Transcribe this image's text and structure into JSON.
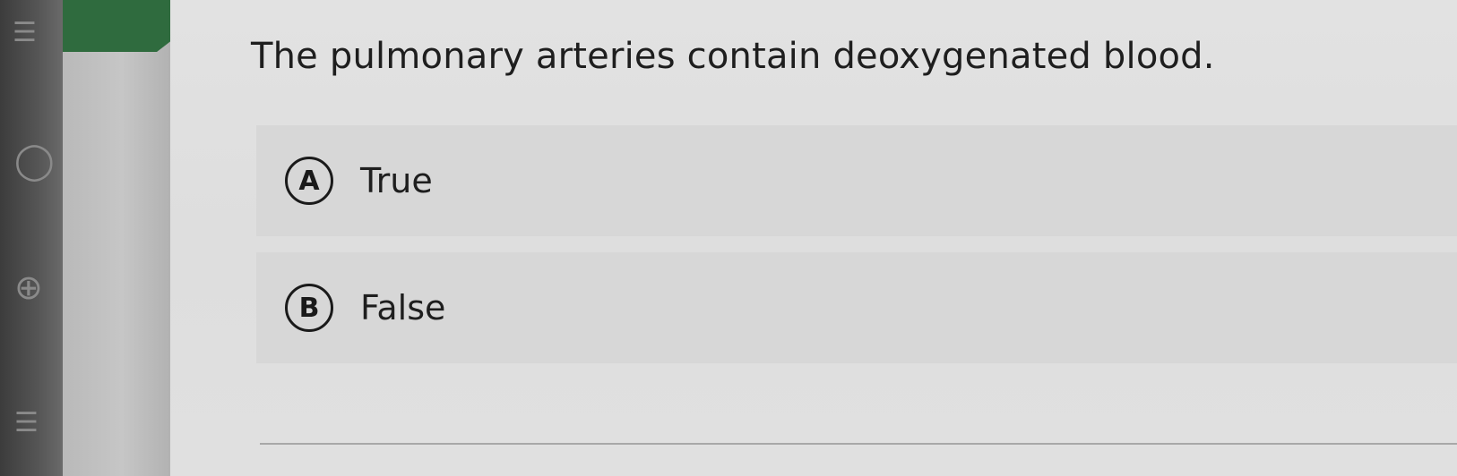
{
  "question": {
    "text": "The pulmonary arteries contain deoxygenated blood."
  },
  "options": [
    {
      "letter": "A",
      "label": "True"
    },
    {
      "letter": "B",
      "label": "False"
    }
  ],
  "colors": {
    "accent_tab": "#2f6b3e",
    "panel_bg": "#e0e0e0",
    "option_bg": "#d7d7d7",
    "text": "#1e1e1e"
  },
  "sidebar_icons": [
    "user-icon",
    "globe-icon",
    "list-icon"
  ]
}
